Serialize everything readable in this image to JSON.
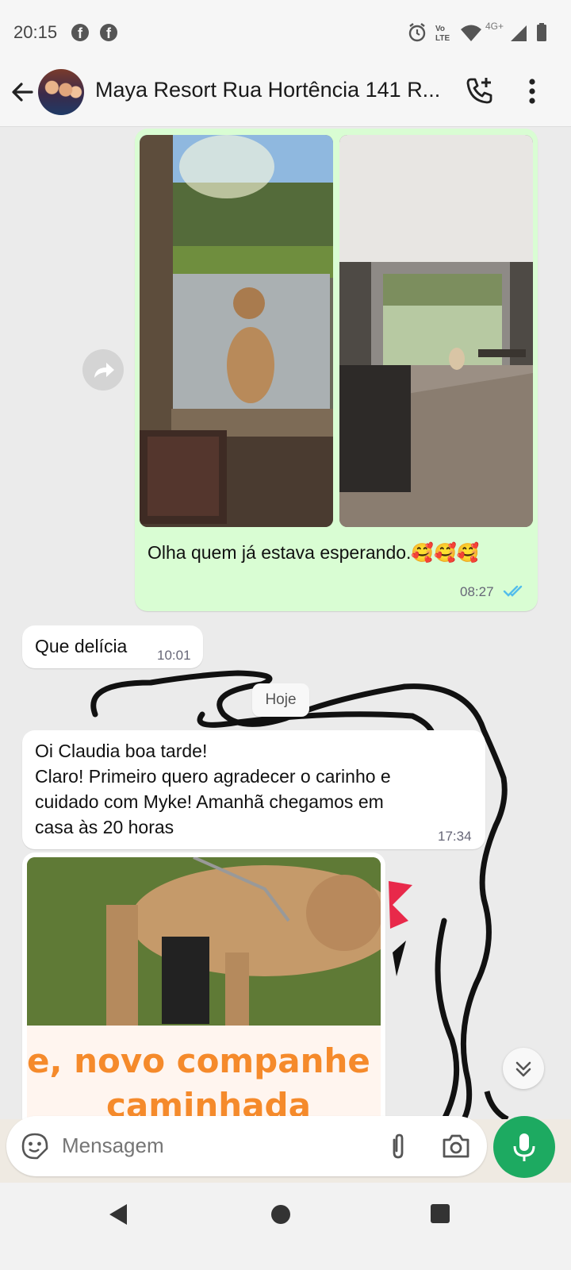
{
  "status_bar": {
    "time": "20:15",
    "network": "4G+",
    "volte": "Vo LTE",
    "icons": [
      "facebook-icon",
      "facebook-icon",
      "alarm-icon",
      "volte-icon",
      "wifi-icon",
      "signal-icon",
      "battery-icon"
    ]
  },
  "header": {
    "title": "Maya Resort Rua Hortência 141 R...",
    "icons": [
      "back-arrow-icon",
      "avatar",
      "add-call-icon",
      "more-vert-icon"
    ]
  },
  "messages": [
    {
      "type": "outgoing",
      "text": "Olha quem já estava esperando.🥰🥰🥰",
      "time": "08:27",
      "status": "read"
    },
    {
      "type": "incoming",
      "text": "Que delícia",
      "time": "10:01"
    },
    {
      "type": "date",
      "text": "Hoje"
    },
    {
      "type": "incoming",
      "lines": [
        "Oi Claudia boa tarde!",
        "Claro! Primeiro quero agradecer o carinho e",
        "cuidado com Myke! Amanhã  chegamos em",
        "casa às 20 horas"
      ],
      "time": "17:34"
    },
    {
      "type": "incoming-image",
      "overlay_text": [
        "e, novo companhe",
        "caminhada"
      ]
    }
  ],
  "composer": {
    "placeholder": "Mensagem"
  },
  "colors": {
    "outgoing_bubble": "#d9fdd3",
    "incoming_bubble": "#ffffff",
    "mic_button": "#1daa61",
    "read_ticks": "#53bdeb",
    "overlay_orange": "#f58a2b"
  }
}
